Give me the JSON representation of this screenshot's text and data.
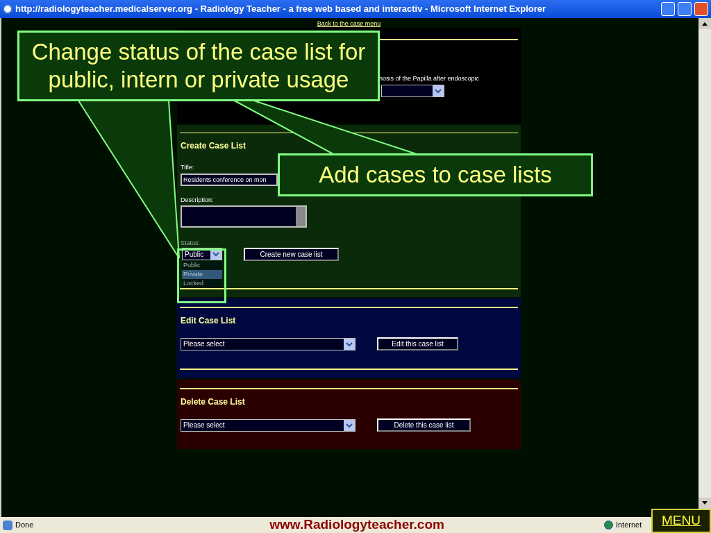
{
  "window": {
    "title": "http://radiologyteacher.medicalserver.org - Radiology Teacher - a free web based and interactiv - Microsoft Internet Explorer"
  },
  "page": {
    "back_link": "Back to the case menu",
    "top_section": {
      "text": "nosis of the Papilla after endoscopic"
    },
    "create": {
      "heading": "Create Case List",
      "title_label": "Title:",
      "title_value": "Residents conference on mon",
      "description_label": "Description:",
      "status_label": "Status:",
      "status_value": "Public",
      "status_options": [
        {
          "label": "Public",
          "selected": false
        },
        {
          "label": "Private",
          "selected": true
        },
        {
          "label": "Locked",
          "selected": false
        }
      ],
      "button": "Create new case list"
    },
    "edit": {
      "heading": "Edit Case List",
      "select_value": "Please select",
      "button": "Edit this case list"
    },
    "delete": {
      "heading": "Delete Case List",
      "select_value": "Please select",
      "button": "Delete this case list"
    }
  },
  "callouts": [
    {
      "text": "Change status of the case list for public, intern or private usage"
    },
    {
      "text": "Add cases to case lists"
    }
  ],
  "status_bar": {
    "status": "Done",
    "zone": "Internet"
  },
  "slide_footer": {
    "url": "www.Radiologyteacher.com",
    "menu_button": "MENU"
  }
}
